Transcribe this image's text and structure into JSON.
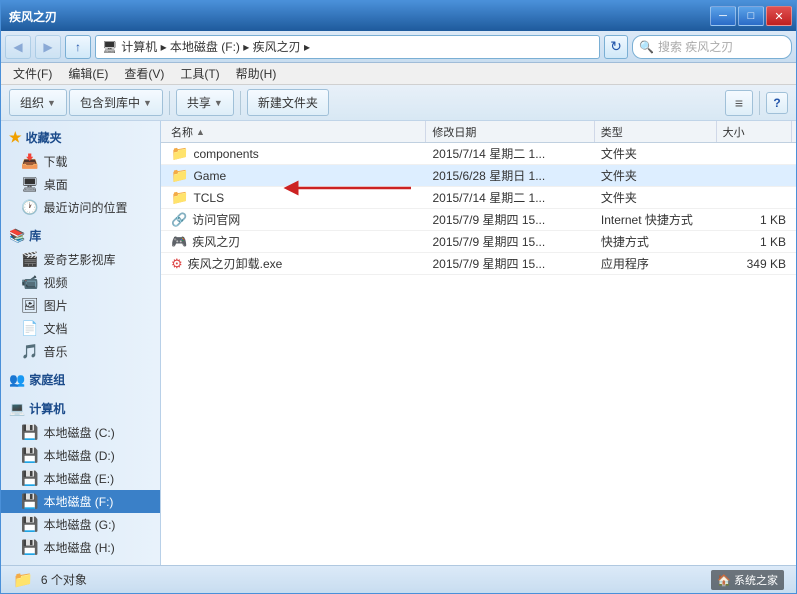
{
  "window": {
    "title": "疾风之刃",
    "title_buttons": {
      "minimize": "─",
      "maximize": "□",
      "close": "✕"
    }
  },
  "address_bar": {
    "back_btn": "◀",
    "forward_btn": "▶",
    "up_btn": "↑",
    "breadcrumb": "计算机 ▸ 本地磁盘 (F:) ▸ 疾风之刃 ▸",
    "search_placeholder": "搜索 疾风之刃",
    "refresh": "↻"
  },
  "menu": {
    "items": [
      "文件(F)",
      "编辑(E)",
      "查看(V)",
      "工具(T)",
      "帮助(H)"
    ]
  },
  "toolbar": {
    "organize": "组织",
    "include_library": "包含到库中",
    "share": "共享",
    "new_folder": "新建文件夹",
    "view_label": "≡",
    "help": "?"
  },
  "columns": {
    "name": "名称",
    "date_modified": "修改日期",
    "type": "类型",
    "size": "大小"
  },
  "files": [
    {
      "name": "components",
      "icon": "folder",
      "date": "2015/7/14 星期二 1...",
      "type": "文件夹",
      "size": ""
    },
    {
      "name": "Game",
      "icon": "folder",
      "date": "2015/6/28 星期日 1...",
      "type": "文件夹",
      "size": "",
      "highlighted": true
    },
    {
      "name": "TCLS",
      "icon": "folder",
      "date": "2015/7/14 星期二 1...",
      "type": "文件夹",
      "size": ""
    },
    {
      "name": "访问官网",
      "icon": "shortcut",
      "date": "2015/7/9 星期四 15...",
      "type": "Internet 快捷方式",
      "size": "1 KB"
    },
    {
      "name": "疾风之刃",
      "icon": "shortcut",
      "date": "2015/7/9 星期四 15...",
      "type": "快捷方式",
      "size": "1 KB"
    },
    {
      "name": "疾风之刃卸载.exe",
      "icon": "exe",
      "date": "2015/7/9 星期四 15...",
      "type": "应用程序",
      "size": "349 KB"
    }
  ],
  "sidebar": {
    "favorites_label": "收藏夹",
    "favorites_items": [
      {
        "label": "下载",
        "icon": "📥"
      },
      {
        "label": "桌面",
        "icon": "🖥"
      },
      {
        "label": "最近访问的位置",
        "icon": "🕐"
      }
    ],
    "library_label": "库",
    "library_items": [
      {
        "label": "爱奇艺影视库",
        "icon": "🎬"
      },
      {
        "label": "视频",
        "icon": "📹"
      },
      {
        "label": "图片",
        "icon": "🖼"
      },
      {
        "label": "文档",
        "icon": "📄"
      },
      {
        "label": "音乐",
        "icon": "🎵"
      }
    ],
    "homegroup_label": "家庭组",
    "computer_label": "计算机",
    "drives": [
      {
        "label": "本地磁盘 (C:)",
        "icon": "💾"
      },
      {
        "label": "本地磁盘 (D:)",
        "icon": "💾"
      },
      {
        "label": "本地磁盘 (E:)",
        "icon": "💾"
      },
      {
        "label": "本地磁盘 (F:)",
        "icon": "💾",
        "active": true
      },
      {
        "label": "本地磁盘 (G:)",
        "icon": "💾"
      },
      {
        "label": "本地磁盘 (H:)",
        "icon": "💾"
      }
    ]
  },
  "status_bar": {
    "count": "6 个对象",
    "watermark": "系统之家"
  },
  "colors": {
    "accent": "#3a80c8",
    "folder": "#f0a000",
    "selected_bg": "#cce0f8",
    "highlighted_bg": "#ddeeff"
  }
}
